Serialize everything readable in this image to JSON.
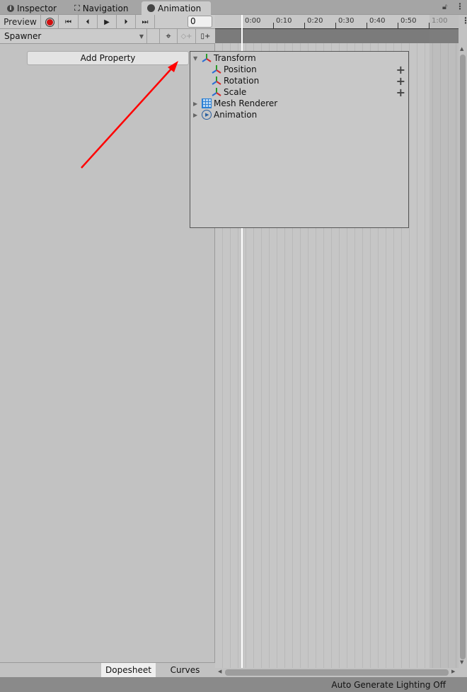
{
  "tabs": [
    {
      "label": "Inspector",
      "icon": "info-icon"
    },
    {
      "label": "Navigation",
      "icon": "navigation-icon"
    },
    {
      "label": "Animation",
      "icon": "clock-icon",
      "active": true
    }
  ],
  "toolbar": {
    "preview_label": "Preview",
    "frame_value": "0"
  },
  "clip": {
    "selected": "Spawner"
  },
  "left": {
    "add_property_label": "Add Property"
  },
  "timeline": {
    "ticks": [
      "0:00",
      "0:10",
      "0:20",
      "0:30",
      "0:40",
      "0:50",
      "1:00"
    ]
  },
  "popup": {
    "items": [
      {
        "label": "Transform",
        "expanded": true
      },
      {
        "label": "Position",
        "child": true
      },
      {
        "label": "Rotation",
        "child": true
      },
      {
        "label": "Scale",
        "child": true
      },
      {
        "label": "Mesh Renderer",
        "expanded": false
      },
      {
        "label": "Animation",
        "expanded": false
      }
    ]
  },
  "bottom": {
    "dopesheet_label": "Dopesheet",
    "curves_label": "Curves"
  },
  "status": {
    "text": "Auto Generate Lighting Off"
  },
  "colors": {
    "annotation_arrow": "#ff0000",
    "record": "#d01010"
  }
}
